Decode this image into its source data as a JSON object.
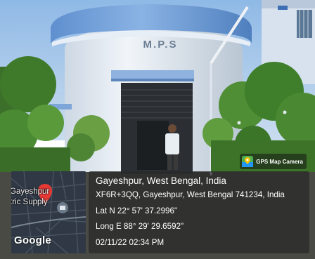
{
  "watermark": {
    "building_sign": "M.P.S",
    "app_badge": {
      "icon": "gps-map-camera-icon",
      "label": "GPS Map Camera"
    },
    "map_thumbnail": {
      "place_label_line1": "Gayeshpur",
      "place_label_line2": "tric Supply",
      "logo_text": "Google"
    },
    "location": {
      "title": "Gayeshpur, West Bengal, India",
      "address": "XF6R+3QQ, Gayeshpur, West Bengal 741234, India",
      "latitude": "Lat N 22° 57' 37.2996\"",
      "longitude": "Long E 88° 29' 29.6592\"",
      "datetime": "02/11/22 02:34 PM"
    }
  },
  "colors": {
    "sky": "#9fc4e8",
    "building": "#e8eef4",
    "band": "#6f9ed8",
    "foliage": "#3f7b2c",
    "pin": "#e53935"
  }
}
